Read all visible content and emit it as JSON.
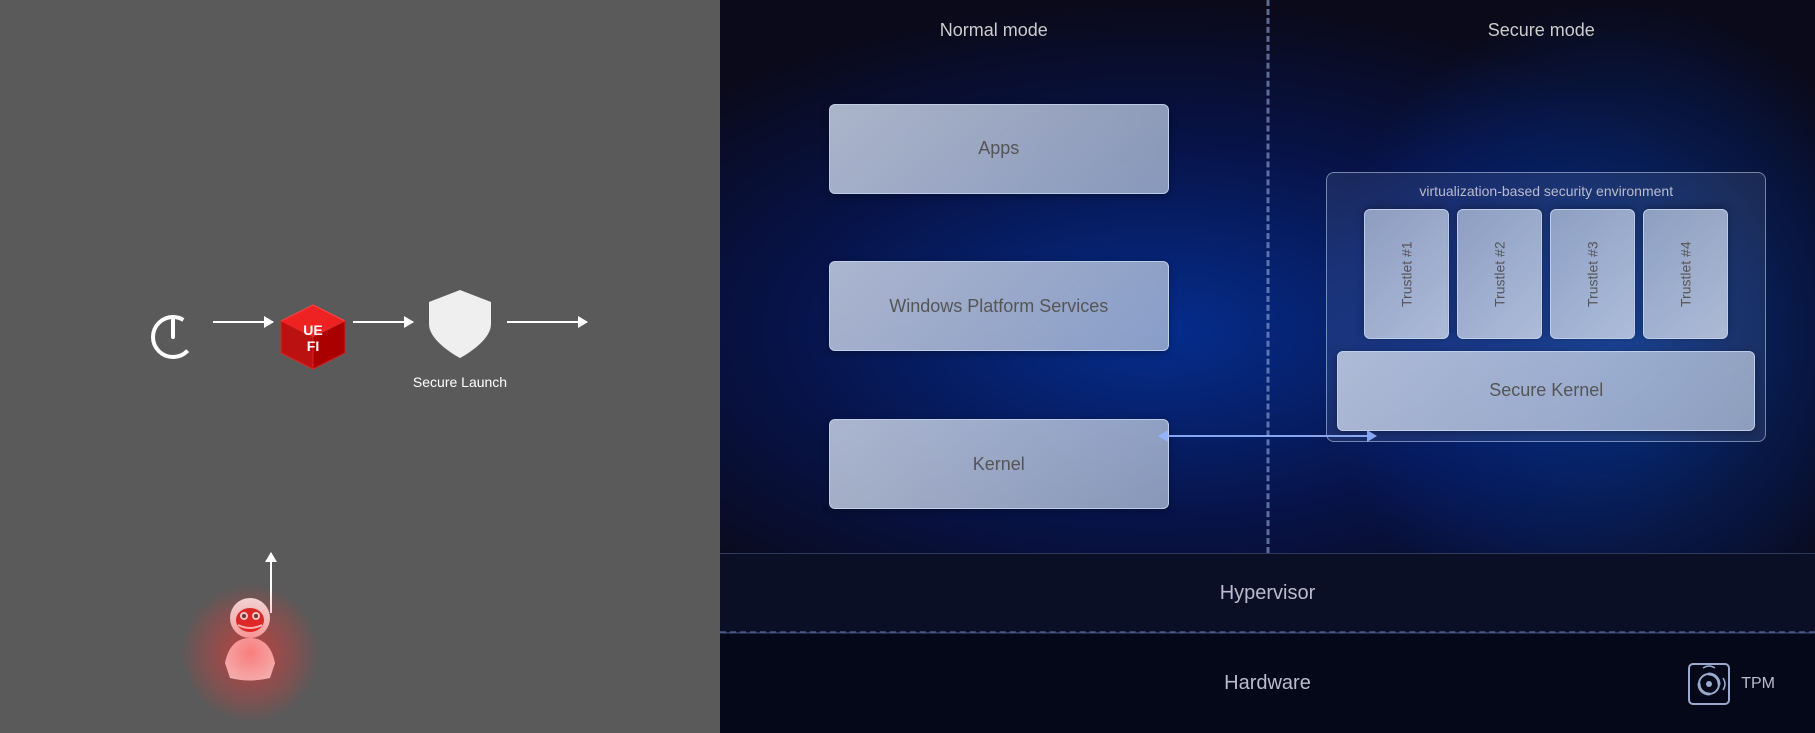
{
  "left": {
    "icons": {
      "power": "⏻",
      "uefi_label": "UEFI",
      "shield_label": "Secure Launch"
    },
    "attacker_arrow_tooltip": "attacker trying to compromise boot"
  },
  "right": {
    "normal_mode_label": "Normal mode",
    "secure_mode_label": "Secure mode",
    "vbs_label": "virtualization-based security environment",
    "layers": {
      "apps": "Apps",
      "windows_platform_services": "Windows Platform Services",
      "kernel": "Kernel",
      "secure_kernel": "Secure Kernel",
      "hypervisor": "Hypervisor",
      "hardware": "Hardware"
    },
    "trustlets": [
      "Trustlet #1",
      "Trustlet #2",
      "Trustlet #3",
      "Trustlet #4"
    ],
    "tpm_label": "TPM"
  }
}
